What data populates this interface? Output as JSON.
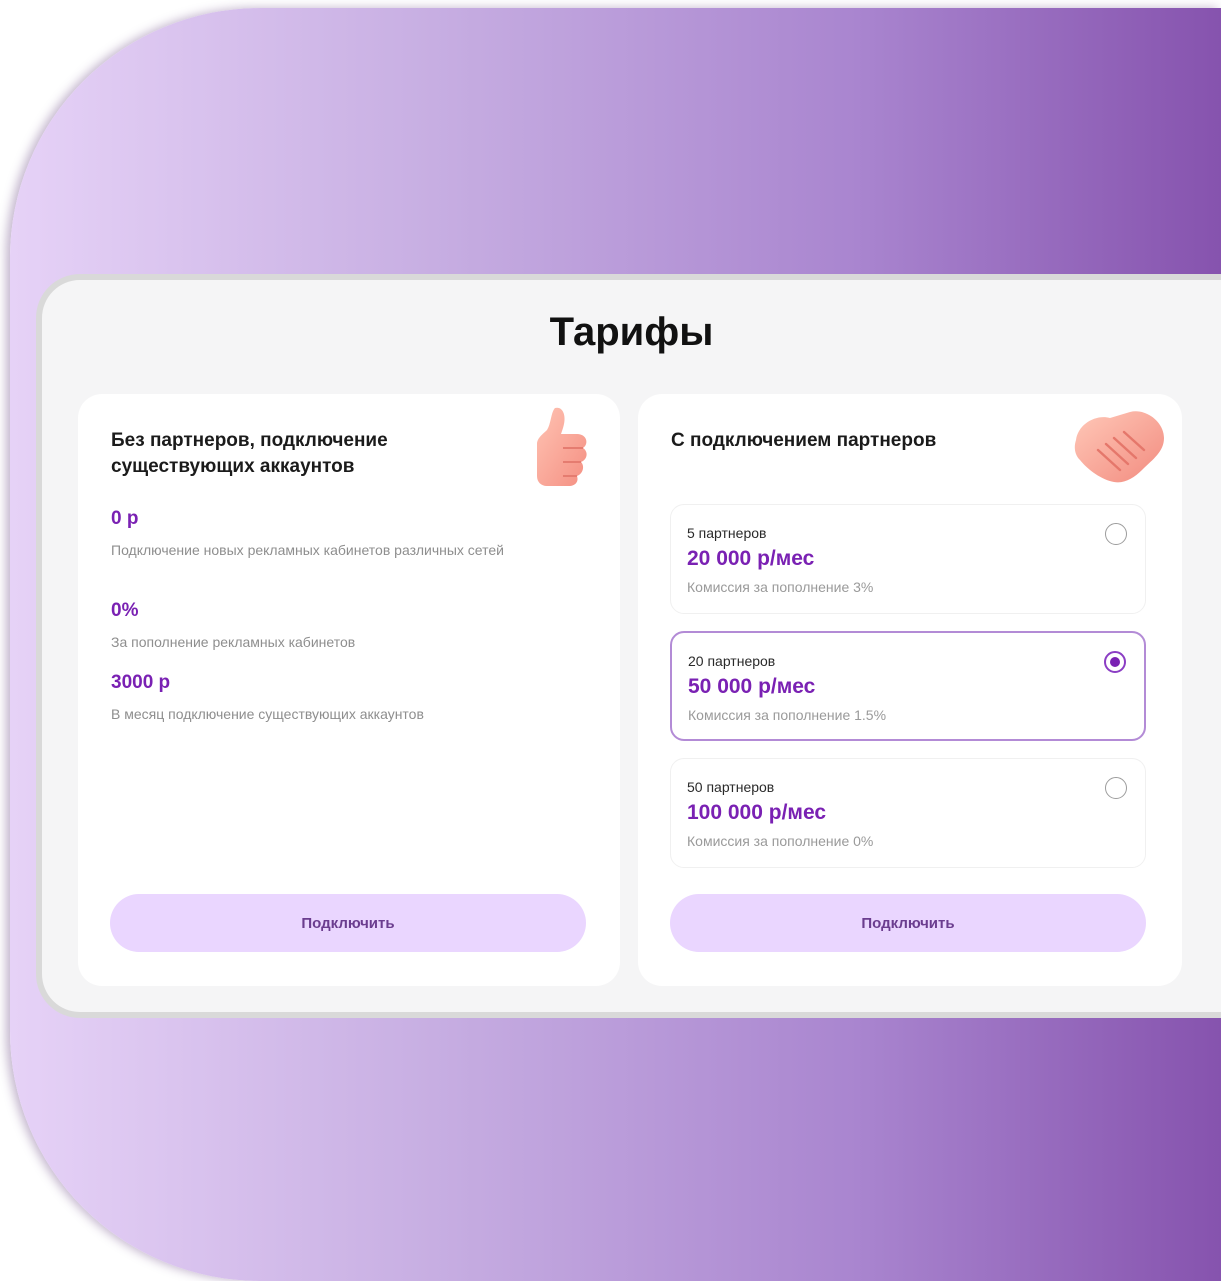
{
  "page": {
    "title": "Тарифы"
  },
  "colors": {
    "accent": "#7a21b3",
    "button_bg": "#ead6ff",
    "background_gradient_end": "#8653ae"
  },
  "left_plan": {
    "heading": "Без партнеров, подключение существующих аккаунтов",
    "icon": "thumbs-up-icon",
    "stats": [
      {
        "value": "0 р",
        "description": "Подключение новых рекламных кабинетов различных сетей"
      },
      {
        "value": "0%",
        "description": "За пополнение рекламных кабинетов"
      },
      {
        "value": "3000 р",
        "description": "В месяц подключение существующих аккаунтов"
      }
    ],
    "button_label": "Подключить"
  },
  "right_plan": {
    "heading": "С подключением партнеров",
    "icon": "handshake-icon",
    "options": [
      {
        "name": "5 партнеров",
        "price": "20 000 р/мес",
        "fee": "Комиссия за пополнение 3%",
        "selected": false
      },
      {
        "name": "20 партнеров",
        "price": "50 000 р/мес",
        "fee": "Комиссия за пополнение 1.5%",
        "selected": true
      },
      {
        "name": "50 партнеров",
        "price": "100 000 р/мес",
        "fee": "Комиссия за пополнение 0%",
        "selected": false
      }
    ],
    "button_label": "Подключить"
  }
}
